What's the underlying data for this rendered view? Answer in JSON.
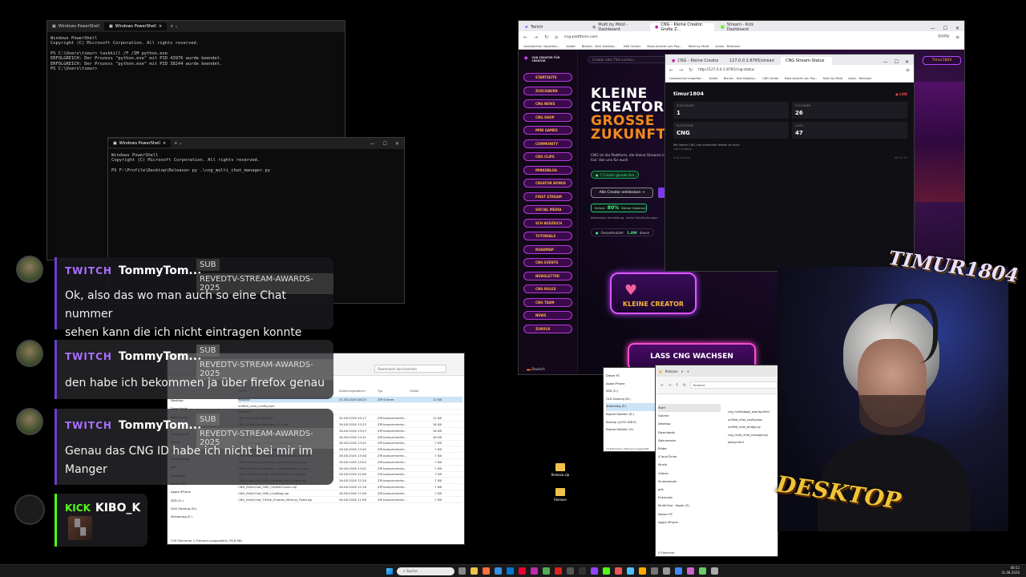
{
  "ps1": {
    "tabs": [
      "Windows PowerShell",
      "Windows PowerShell"
    ],
    "lines": [
      "Windows PowerShell",
      "Copyright (C) Microsoft Corporation. All rights reserved.",
      "",
      "PS C:\\Users\\timur> taskkill /F /IM python.exe",
      "ERFOLGREICH: Der Prozess \"python.exe\" mit PID 43976 wurde beendet.",
      "ERFOLGREICH: Der Prozess \"python.exe\" mit PID 38244 wurde beendet.",
      "PS C:\\Users\\timur>"
    ]
  },
  "ps2": {
    "tab": "Windows PowerShell",
    "lines": [
      "Windows PowerShell",
      "Copyright (C) Microsoft Corporation. All rights reserved.",
      "",
      "PS F:\\Profile\\Desktop\\Release> py .\\cng_multi_chat_manager.py"
    ]
  },
  "chat": {
    "messages": [
      {
        "platform": "TWITCH",
        "user": "TommyTom...",
        "badge1": "SUB",
        "badge2": "REVEDTV-STREAM-AWARDS-2025",
        "text1": "Ok, also das wo man auch so eine Chat nummer",
        "text2": "sehen kann die ich nicht eintragen konnte"
      },
      {
        "platform": "TWITCH",
        "user": "TommyTom...",
        "badge1": "SUB",
        "badge2": "REVEDTV-STREAM-AWARDS-2025",
        "text1": "den habe ich bekommen ja über firefox genau"
      },
      {
        "platform": "TWITCH",
        "user": "TommyTom...",
        "badge1": "SUB",
        "badge2": "REVEDTV-STREAM-AWARDS-2025",
        "text1": "Genau das CNG ID habe ich nicht bei mir im",
        "text2": "Manger"
      },
      {
        "platform": "KICK",
        "user": "KIBO_K"
      }
    ]
  },
  "browser": {
    "tabs": [
      "Twitch",
      "Multi by Mold - Dashboard",
      "CNG - Kleine Creator. Große Z...",
      "Stream - Kick Dashboard"
    ],
    "url": "cng-plattform.com",
    "vpn": "VPN",
    "bookmarks": [
      "Lesezeichen importier...",
      "Arbeit",
      "Bienen - Kick Dashbo...",
      "UWI Center",
      "Most Ansicht von Pay...",
      "Multi by Mold",
      "vision · Remixen"
    ],
    "sidebar_brand": "VON CREATOR FÜR CREATOR",
    "search_placeholder": "Creator oder Titel suchen...",
    "sidebar_items": [
      "STARTSEITE",
      "ZUSCHAUEN",
      "CNG NEWS",
      "CNG SHOP",
      "MINI GAMES",
      "COMMUNITY",
      "CNG CLIPS",
      "MIRKOBLOG",
      "CREATOR BONUS",
      "FIRST STREAM",
      "SOCIAL MEDIA",
      "SCH AUSZEICH",
      "TUTORIALS",
      "ROADMAP",
      "CNG EVENTS",
      "NEWSLETTER",
      "CNG RULES",
      "CNG TEAM",
      "NEWS",
      "ZURÜCK"
    ],
    "language": "Deutsch",
    "hero_line1": "KLEINE",
    "hero_line2": "CREATOR",
    "hero_line3": "GROSSE",
    "hero_line4": "ZUKUNFT",
    "hero_desc1": "CNG ist die Plattform, die kleine Streams in",
    "hero_desc2": "Fair. Von uns für euch.",
    "live_badge": "7 Creator gerade live",
    "discover_btn": "Alle Creator entdecken",
    "share_label": "Schutz",
    "share_pct": "80%",
    "share_text": "Deiner Gewinne",
    "free_text": "Kostenlose Anmeldung · keine Verpflichtungen",
    "users_label": "Gesamtnutzer:",
    "users_value": "1.498",
    "users_suffix": "davon",
    "promo1": "KLEINE CREATOR",
    "promo2": "LASS CNG WACHSEN",
    "user_btn": "Timur1804"
  },
  "stats_browser": {
    "tabs": [
      "CNG - Kleine Creator. Große Z...",
      "127.0.0.1:8765/stream-status",
      "CNG Stream-Status"
    ],
    "url": "http://127.0.0.1:8765/cng-status",
    "bookmarks": [
      "Lesezeichen importier...",
      "Arbeit",
      "Bienen - Kick Dashbo...",
      "UWI Center",
      "Most Ansicht von Pay...",
      "Multi by Mold",
      "vision · Remixen"
    ],
    "username": "timur1804",
    "live": "LIVE",
    "stats": [
      {
        "label": "ZUSCHAUER",
        "value": "1"
      },
      {
        "label": "FOLLOWER",
        "value": "26"
      },
      {
        "label": "PLATTFORM",
        "value": "CNG"
      },
      {
        "label": "LEVEL",
        "value": "47"
      }
    ],
    "note1": "Wir lieben CNG und entwickelt bieten an auch",
    "note2": "conf Chatlog",
    "footer_left": "Ansi Ausfall",
    "footer_right": "00:01:10"
  },
  "explorer1": {
    "path": "Downloads durchsuchen",
    "columns": [
      "Name",
      "Änderungsdatum",
      "Typ",
      "Größe"
    ],
    "nav": [
      "Desktop",
      "Downloads",
      "Dokumente",
      "Bilder",
      "iCloud Drive",
      "Musik",
      "Videos",
      "Screenshots",
      "gifs",
      "Exkursion",
      "Dieser PC",
      "Apple iPhone",
      "SSD (C:)",
      "OLD Gaming (D:)",
      "Streaming (F:)"
    ],
    "files": [
      {
        "name": "Release",
        "date": "31.08.2026 08:23",
        "type": "ZIP-Ordner",
        "size": "11 KB"
      },
      {
        "name": "unified_chat_config.json",
        "date": "",
        "type": "",
        "size": ""
      },
      {
        "name": "Gestern",
        "date": "",
        "type": "",
        "size": ""
      },
      {
        "name": "CNG MultiChat Release",
        "date": "30.08.2026 19:17",
        "type": "ZIP-komprimierte...",
        "size": "11 KB"
      },
      {
        "name": "CNG_MultiChat_Release_V1.2.zip",
        "date": "26.08.2026 13:23",
        "type": "ZIP-komprimierte...",
        "size": "16 KB"
      },
      {
        "name": "CNG_MultiChat_Release_V1.1.zip",
        "date": "26.08.2026 13:23",
        "type": "ZIP-komprimierte...",
        "size": "16 KB"
      },
      {
        "name": "CNG_MultiChat_Release_V1_FINAL.zip",
        "date": "26.08.2026 13:41",
        "type": "ZIP-komprimierte...",
        "size": "16 KB"
      },
      {
        "name": "CNG_MultiChat_Overlay_ChatterColors.zip",
        "date": "26.08.2026 13:40",
        "type": "ZIP-komprimierte...",
        "size": "7 KB"
      },
      {
        "name": "CNG_MultiChat_AutoHide_Overlay",
        "date": "26.08.2026 13:40",
        "type": "ZIP-komprimierte...",
        "size": "7 KB"
      },
      {
        "name": "CNG_MultiChat_Overlay_ChatterColors_Final.zip",
        "date": "26.08.2026 13:06",
        "type": "ZIP-komprimierte...",
        "size": "7 KB"
      },
      {
        "name": "CNG_MultiChat_Overlay_ChatterColors_v2.zip",
        "date": "26.08.2026 13:04",
        "type": "ZIP-komprimierte...",
        "size": "7 KB"
      },
      {
        "name": "CNG_MultiChat_Overlay_ChatterColors_v2.zip",
        "date": "26.08.2026 13:02",
        "type": "ZIP-komprimierte...",
        "size": "7 KB"
      },
      {
        "name": "CNG_MultiChat_OBS_ChatterColors_FixedLay",
        "date": "26.08.2026 12:58",
        "type": "ZIP-komprimierte...",
        "size": "7 KB"
      },
      {
        "name": "CNG_MultiChat_OBS_ChatterColors_Fixed.zip",
        "date": "26.08.2026 12:26",
        "type": "ZIP-komprimierte...",
        "size": "7 KB"
      },
      {
        "name": "CNG_MultiChat_OBS_ChatterColors.zip",
        "date": "26.08.2026 12:18",
        "type": "ZIP-komprimierte...",
        "size": "7 KB"
      },
      {
        "name": "CNG_MultiChat_OBS_LiveBlog.zip",
        "date": "26.08.2026 11:58",
        "type": "ZIP-komprimierte...",
        "size": "7 KB"
      },
      {
        "name": "CNG_MultiChat_TikTok_Emotes_Mehrus_Fixed.zip",
        "date": "26.08.2026 11:58",
        "type": "ZIP-komprimierte...",
        "size": "7 KB"
      }
    ],
    "status": "239 Elemente   1 Element ausgewählt (76,8 KB)"
  },
  "explorer2": {
    "title": "Release",
    "path": "Release",
    "nav": [
      "Start",
      "Galerie",
      "Desktop",
      "Downloads",
      "Dokumente",
      "Bilder",
      "iCloud Drive",
      "Musik",
      "Videos",
      "Screenshots",
      "gifs",
      "Exkursion",
      "MultiChat - Kopie (3)",
      "Dieser PC",
      "Apple iPhone"
    ],
    "files": [
      "cng_multiadapt_overlay.html",
      "unified_chat_config.json",
      "unified_chat_bridge.py",
      "cng_multi_chat_manager.py",
      "plasty.html"
    ],
    "status": "5 Elemente"
  },
  "explorer3": {
    "nav": [
      "Dieser PC",
      "Apple iPhone",
      "SSD (C:)",
      "OLD Gaming (D:)",
      "Streaming (F:)",
      "Eigene Dateien (E:)",
      "Backup (\\\\192.168.9)",
      "Eigene Dateien (Y:)"
    ],
    "status": "10 Elemente   1 Element ausgewählt"
  },
  "desktop_icons": [
    "Release.zip",
    "Release"
  ],
  "webcam": {
    "top_tag": "TIMUR1804",
    "bottom_tag": "DESKTOP"
  },
  "taskbar": {
    "search": "Suche",
    "time": "08:52",
    "date": "31.08.2026"
  }
}
